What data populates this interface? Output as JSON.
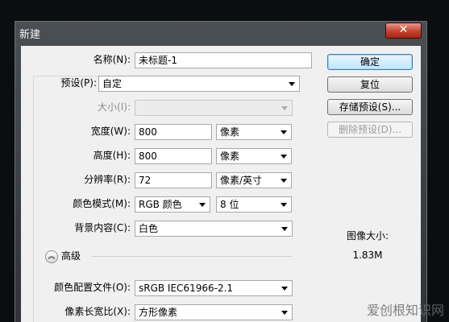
{
  "window": {
    "title": "新建",
    "close_glyph": "✕"
  },
  "form": {
    "name": {
      "label": "名称(N):",
      "value": "未标题-1"
    },
    "preset": {
      "label": "预设(P):",
      "value": "自定"
    },
    "size": {
      "label": "大小(I):",
      "value": ""
    },
    "width": {
      "label": "宽度(W):",
      "value": "800",
      "unit": "像素"
    },
    "height": {
      "label": "高度(H):",
      "value": "800",
      "unit": "像素"
    },
    "resolution": {
      "label": "分辨率(R):",
      "value": "72",
      "unit": "像素/英寸"
    },
    "color_mode": {
      "label": "颜色模式(M):",
      "value": "RGB 颜色",
      "depth": "8 位"
    },
    "background": {
      "label": "背景内容(C):",
      "value": "白色"
    },
    "advanced": {
      "label": "高级",
      "toggle_glyph": "︽"
    },
    "color_profile": {
      "label": "颜色配置文件(O):",
      "value": "sRGB IEC61966-2.1"
    },
    "pixel_aspect": {
      "label": "像素长宽比(X):",
      "value": "方形像素"
    }
  },
  "buttons": {
    "ok": "确定",
    "reset": "复位",
    "save_preset": "存储预设(S)...",
    "delete_preset": "删除预设(D)..."
  },
  "image_size": {
    "label": "图像大小:",
    "value": "1.83M"
  },
  "watermark": "爱创根知识网"
}
